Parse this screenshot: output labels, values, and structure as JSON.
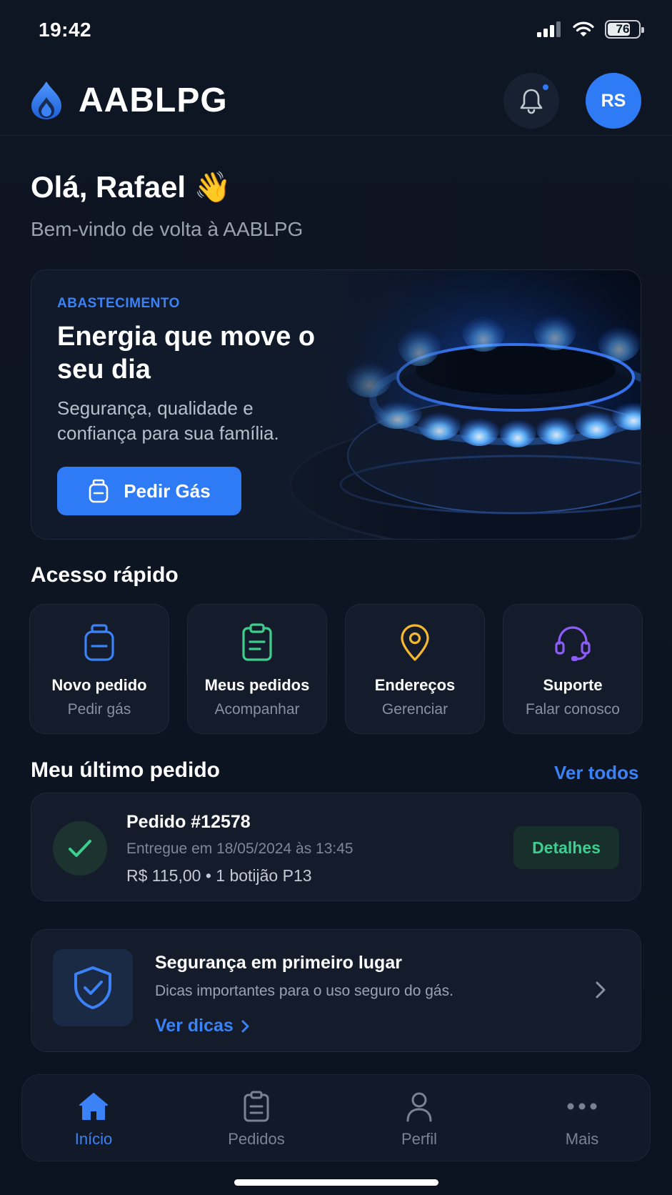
{
  "status_bar": {
    "time": "19:42",
    "battery": "76",
    "battery_level": 0.76
  },
  "header": {
    "app_name": "AABLPG",
    "avatar_initials": "RS"
  },
  "greeting": {
    "title": "Olá, Rafael 👋",
    "subtitle": "Bem-vindo de volta à AABLPG"
  },
  "hero": {
    "tag": "ABASTECIMENTO",
    "title": "Energia que move o seu dia",
    "text": "Segurança, qualidade e confiança para sua família.",
    "button_label": "Pedir Gás"
  },
  "quick_access": {
    "title": "Acesso rápido",
    "items": [
      {
        "label": "Novo pedido",
        "sub": "Pedir gás",
        "icon": "gas-cylinder-icon",
        "color": "#3b82f6"
      },
      {
        "label": "Meus pedidos",
        "sub": "Acompanhar",
        "icon": "clipboard-icon",
        "color": "#3ecf8e"
      },
      {
        "label": "Endereços",
        "sub": "Gerenciar",
        "icon": "map-pin-icon",
        "color": "#f5b82e"
      },
      {
        "label": "Suporte",
        "sub": "Falar conosco",
        "icon": "headset-icon",
        "color": "#8b5cf6"
      }
    ]
  },
  "last_order": {
    "title": "Meu último pedido",
    "see_all": "Ver todos",
    "order_title": "Pedido #12578",
    "date": "Entregue em 18/05/2024 às 13:45",
    "meta": "R$ 115,00 • 1 botijão P13",
    "details_label": "Detalhes"
  },
  "safety": {
    "title": "Segurança em primeiro lugar",
    "text": "Dicas importantes para o uso seguro do gás.",
    "link": "Ver dicas"
  },
  "tab_bar": {
    "items": [
      {
        "label": "Início",
        "icon": "home-icon",
        "active": true
      },
      {
        "label": "Pedidos",
        "icon": "clipboard-icon",
        "active": false
      },
      {
        "label": "Perfil",
        "icon": "user-icon",
        "active": false
      },
      {
        "label": "Mais",
        "icon": "more-icon",
        "active": false
      }
    ]
  },
  "colors": {
    "accent": "#2f7bf6",
    "success": "#3ecf8e",
    "background": "#0d1421",
    "card": "#141c2b"
  }
}
